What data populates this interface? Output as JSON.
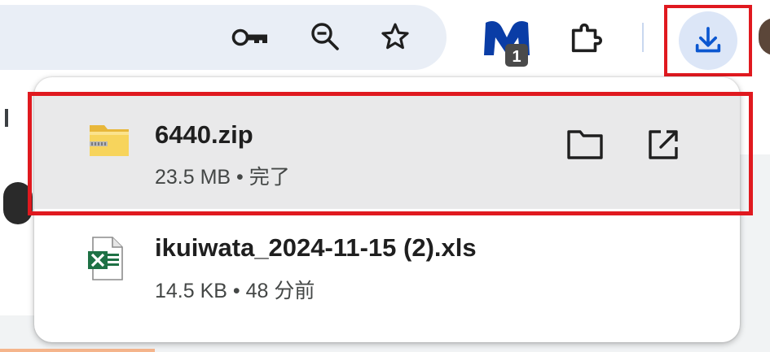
{
  "toolbar": {
    "extension_badge": "1",
    "icons": [
      "key-icon",
      "zoom-out-icon",
      "star-icon",
      "extension-icon",
      "puzzle-icon",
      "download-icon"
    ],
    "accent_color": "#0b57d0",
    "highlight_color": "#e0191f"
  },
  "downloads": {
    "items": [
      {
        "name": "6440.zip",
        "meta": "23.5 MB • 完了",
        "icon": "zip-folder-icon"
      },
      {
        "name": "ikuiwata_2024-11-15 (2).xls",
        "meta": "14.5 KB • 48 分前",
        "icon": "excel-file-icon"
      }
    ]
  }
}
